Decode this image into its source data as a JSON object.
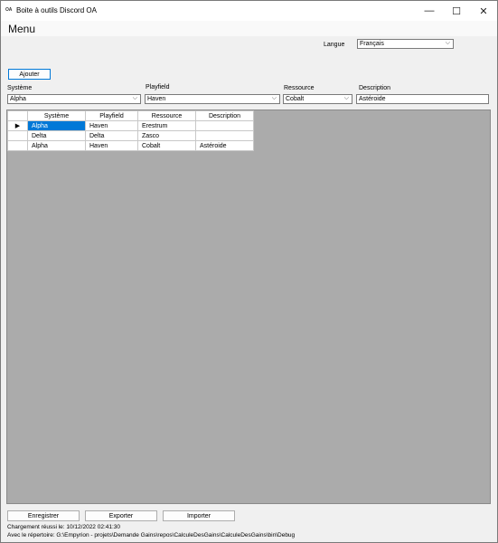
{
  "window": {
    "icon_text": "OA",
    "title": "Boite à outils Discord OA",
    "controls": {
      "minimize": "—",
      "maximize": "☐",
      "close": "✕"
    }
  },
  "menu": {
    "label": "Menu"
  },
  "language": {
    "label": "Langue",
    "value": "Français"
  },
  "toolbar": {
    "add_label": "Ajouter"
  },
  "filters": {
    "system": {
      "label": "Système",
      "value": "Alpha"
    },
    "playfield": {
      "label": "Playfield",
      "value": "Haven"
    },
    "resource": {
      "label": "Ressource",
      "value": "Cobalt"
    },
    "description": {
      "label": "Description",
      "value": "Astéroide"
    }
  },
  "table": {
    "columns": [
      "Système",
      "Playfield",
      "Ressource",
      "Description"
    ],
    "current_row_marker": "▶",
    "rows": [
      {
        "system": "Alpha",
        "playfield": "Haven",
        "resource": "Erestrum",
        "description": ""
      },
      {
        "system": "Delta",
        "playfield": "Delta",
        "resource": "Zasco",
        "description": ""
      },
      {
        "system": "Alpha",
        "playfield": "Haven",
        "resource": "Cobalt",
        "description": "Astéroide"
      }
    ]
  },
  "actions": {
    "save": "Enregistrer",
    "export": "Exporter",
    "import": "Importer"
  },
  "status": {
    "line1": "Chargement réussi le: 10/12/2022 02:41:30",
    "line2": "Avec le répertoire: G:\\Empyrion - projets\\Demande Gains\\repos\\CalculeDesGains\\CalculeDesGains\\bin\\Debug"
  },
  "colors": {
    "selection": "#0078d7",
    "grid_background": "#ababab",
    "focus_border": "#0078d7"
  }
}
